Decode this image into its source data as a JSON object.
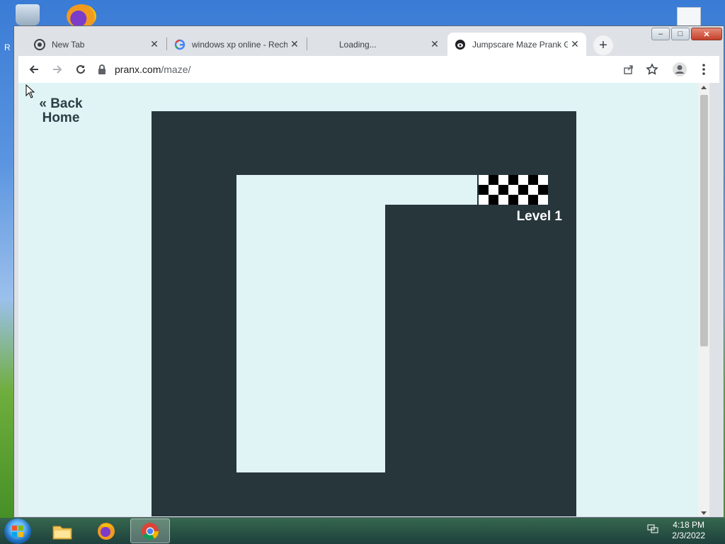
{
  "desktop": {
    "side_letter": "R"
  },
  "browser": {
    "tabs": [
      {
        "label": "New Tab",
        "active": false,
        "favicon": "chrome-icon"
      },
      {
        "label": "windows xp online - Rech",
        "active": false,
        "favicon": "google-icon"
      },
      {
        "label": "Loading...",
        "active": false,
        "favicon": ""
      },
      {
        "label": "Jumpscare Maze Prank G",
        "active": true,
        "favicon": "pranx-icon"
      }
    ],
    "new_tab_label": "+",
    "window_controls": {
      "minimize": "–",
      "maximize": "□",
      "close": "✕"
    },
    "url_host": "pranx.com",
    "url_path": "/maze/"
  },
  "page": {
    "back_link": "« Back Home",
    "level_label": "Level 1",
    "colors": {
      "background": "#e1f4f5",
      "maze_wall": "#27363b",
      "text": "#2c3e45"
    }
  },
  "taskbar": {
    "items": [
      "file-explorer-icon",
      "firefox-icon",
      "chrome-icon"
    ],
    "active_item": "chrome-icon",
    "time": "4:18 PM",
    "date": "2/3/2022"
  }
}
